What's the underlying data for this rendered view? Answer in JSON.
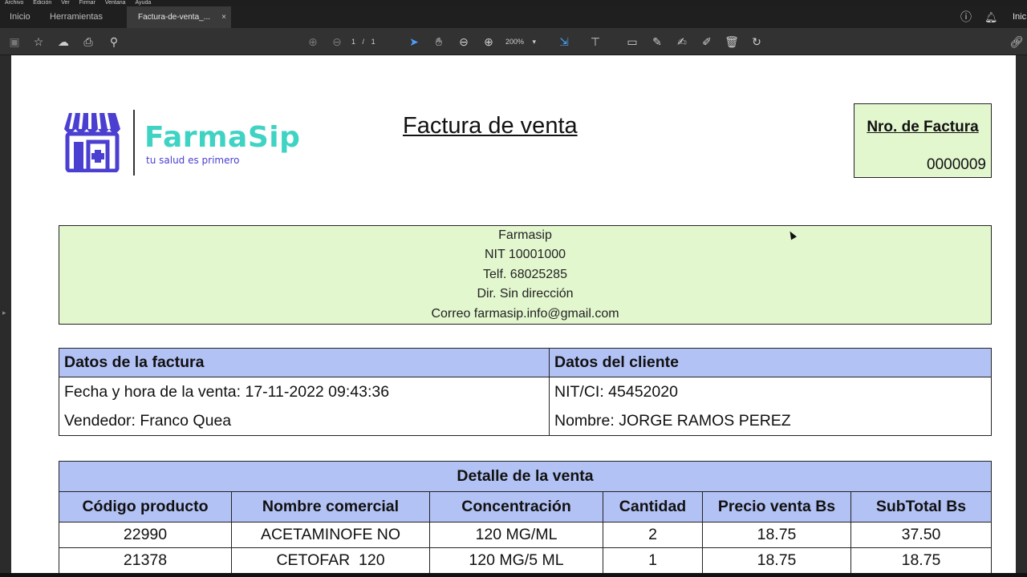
{
  "menubar": {
    "items": [
      "Archivo",
      "Edición",
      "Ver",
      "Firmar",
      "Ventana",
      "Ayuda"
    ]
  },
  "tabs": {
    "home": "Inicio",
    "tools": "Herramientas",
    "active": "Factura-de-venta_...",
    "close": "×",
    "right_label": "Inic"
  },
  "toolbar": {
    "page_current": "1",
    "page_sep": "/",
    "page_total": "1",
    "zoom": "200%"
  },
  "doc": {
    "brand": "FarmaSip",
    "slogan": "tu salud es primero",
    "title": "Factura de venta",
    "invoice_label": "Nro. de Factura",
    "invoice_number": "0000009",
    "company_lines": [
      "Farmasip",
      "NIT 10001000",
      "Telf. 68025285",
      "Dir. Sin dirección",
      "Correo farmasip.info@gmail.com"
    ],
    "info": {
      "left_header": "Datos de la factura",
      "right_header": "Datos del cliente",
      "left_row1": "Fecha y hora de la venta: 17-11-2022 09:43:36",
      "left_row2": "Vendedor: Franco Quea",
      "right_row1": "NIT/CI: 45452020",
      "right_row2": "Nombre: JORGE RAMOS PEREZ"
    },
    "detail": {
      "title": "Detalle de la venta",
      "headers": [
        "Código producto",
        "Nombre comercial",
        "Concentración",
        "Cantidad",
        "Precio venta Bs",
        "SubTotal Bs"
      ],
      "rows": [
        [
          "22990",
          "ACETAMINOFE NO",
          "120 MG/ML",
          "2",
          "18.75",
          "37.50"
        ],
        [
          "21378",
          "CETOFAR  120",
          "120 MG/5 ML",
          "1",
          "18.75",
          "18.75"
        ]
      ]
    }
  },
  "colors": {
    "brand_teal": "#3fd3c4",
    "brand_purple": "#4b3fd1",
    "green_box": "#e3f7cf",
    "header_blue": "#b3c2f5"
  },
  "icons": [
    "save-icon",
    "star-icon",
    "upload-icon",
    "print-icon",
    "zoom-search-icon",
    "page-up-icon",
    "page-down-icon",
    "select-arrow-icon",
    "hand-icon",
    "zoom-out-icon",
    "zoom-in-icon",
    "fit-icon",
    "stamp-icon",
    "comment-icon",
    "pen-icon",
    "sign-icon",
    "edit-icon",
    "trash-icon",
    "rotate-icon",
    "help-icon",
    "bell-icon",
    "link-icon"
  ]
}
